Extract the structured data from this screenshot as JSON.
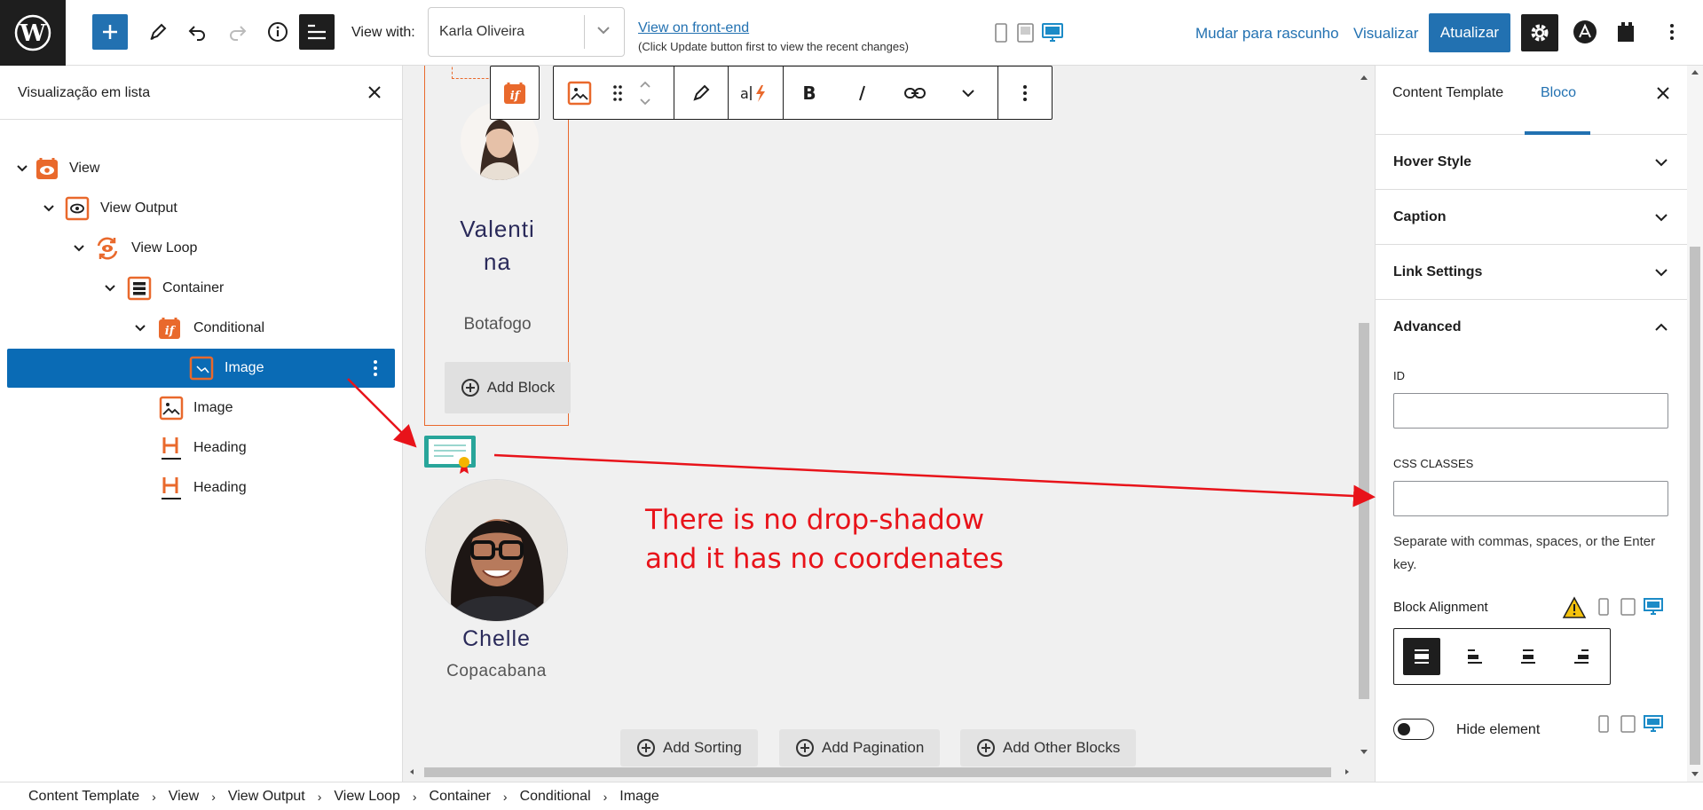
{
  "topbar": {
    "view_with_label": "View with:",
    "view_with_value": "Karla Oliveira",
    "front_end_link": "View on front-end",
    "front_end_note": "(Click Update button first to view the recent changes)",
    "draft_label": "Mudar para rascunho",
    "preview_label": "Visualizar",
    "update_label": "Atualizar"
  },
  "list_view": {
    "title": "Visualização em lista",
    "items": [
      {
        "label": "View",
        "icon": "view-icon"
      },
      {
        "label": "View Output",
        "icon": "view-output-icon"
      },
      {
        "label": "View Loop",
        "icon": "view-loop-icon"
      },
      {
        "label": "Container",
        "icon": "container-icon"
      },
      {
        "label": "Conditional",
        "icon": "conditional-icon"
      },
      {
        "label": "Image",
        "icon": "image-icon"
      },
      {
        "label": "Image",
        "icon": "image-icon"
      },
      {
        "label": "Heading",
        "icon": "heading-icon"
      },
      {
        "label": "Heading",
        "icon": "heading-icon"
      }
    ]
  },
  "canvas": {
    "card1_name": "Valentina",
    "card1_name_line1": "Valenti",
    "card1_name_line2": "na",
    "card1_location": "Botafogo",
    "add_block_label": "Add Block",
    "card2_name": "Chelle",
    "card2_location": "Copacabana",
    "annotation_line1": "There is no drop-shadow",
    "annotation_line2": "and it has no coordenates",
    "add_sorting_label": "Add Sorting",
    "add_pagination_label": "Add Pagination",
    "add_other_label": "Add Other Blocks"
  },
  "settings": {
    "tab_template": "Content Template",
    "tab_block": "Bloco",
    "sections": [
      "Hover Style",
      "Caption",
      "Link Settings",
      "Advanced"
    ],
    "id_label": "ID",
    "css_classes_label": "CSS CLASSES",
    "css_help": "Separate with commas, spaces, or the Enter key.",
    "block_alignment_label": "Block Alignment",
    "hide_element_label": "Hide element"
  },
  "breadcrumb": [
    "Content Template",
    "View",
    "View Output",
    "View Loop",
    "Container",
    "Conditional",
    "Image"
  ],
  "colors": {
    "accent": "#2271b1",
    "selected_row": "#0a6bb5",
    "toolset_orange": "#e9692c",
    "annotation_red": "#e8131a",
    "dark": "#1e1e1e"
  }
}
